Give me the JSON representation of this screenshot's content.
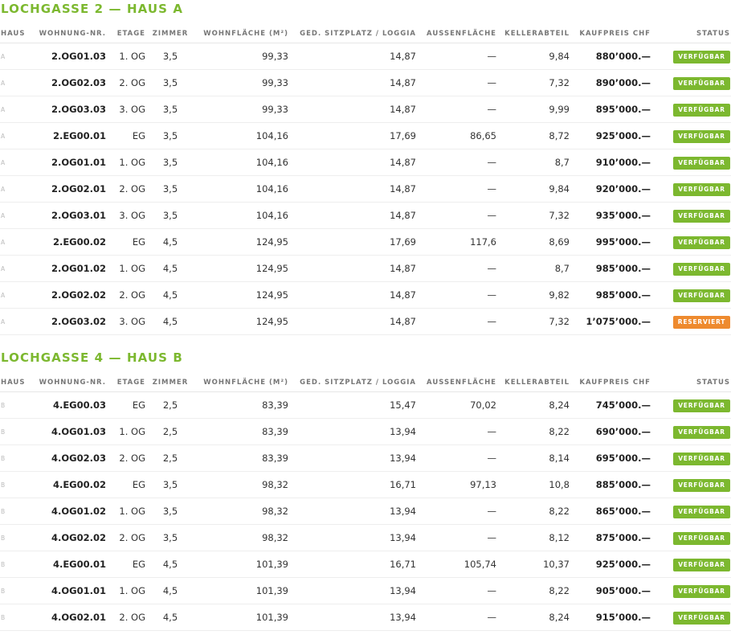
{
  "colors": {
    "accent": "#7cb82f",
    "available": "#7cb82f",
    "reserved": "#ee8a2e"
  },
  "columns": [
    "HAUS",
    "WOHNUNG-NR.",
    "ETAGE",
    "ZIMMER",
    "WOHNFLÄCHE (M²)",
    "GED. SITZPLATZ / LOGGIA",
    "AUSSENFLÄCHE",
    "KELLERABTEIL",
    "KAUFPREIS CHF",
    "STATUS"
  ],
  "sections": [
    {
      "title": "LOCHGASSE 2 — HAUS A",
      "rows": [
        [
          "A",
          "2.OG01.03",
          "1. OG",
          "3,5",
          "99,33",
          "14,87",
          "—",
          "9,84",
          "880’000.—",
          "VERFÜGBAR"
        ],
        [
          "A",
          "2.OG02.03",
          "2. OG",
          "3,5",
          "99,33",
          "14,87",
          "—",
          "7,32",
          "890’000.—",
          "VERFÜGBAR"
        ],
        [
          "A",
          "2.OG03.03",
          "3. OG",
          "3,5",
          "99,33",
          "14,87",
          "—",
          "9,99",
          "895’000.—",
          "VERFÜGBAR"
        ],
        [
          "A",
          "2.EG00.01",
          "EG",
          "3,5",
          "104,16",
          "17,69",
          "86,65",
          "8,72",
          "925’000.—",
          "VERFÜGBAR"
        ],
        [
          "A",
          "2.OG01.01",
          "1. OG",
          "3,5",
          "104,16",
          "14,87",
          "—",
          "8,7",
          "910’000.—",
          "VERFÜGBAR"
        ],
        [
          "A",
          "2.OG02.01",
          "2. OG",
          "3,5",
          "104,16",
          "14,87",
          "—",
          "9,84",
          "920’000.—",
          "VERFÜGBAR"
        ],
        [
          "A",
          "2.OG03.01",
          "3. OG",
          "3,5",
          "104,16",
          "14,87",
          "—",
          "7,32",
          "935’000.—",
          "VERFÜGBAR"
        ],
        [
          "A",
          "2.EG00.02",
          "EG",
          "4,5",
          "124,95",
          "17,69",
          "117,6",
          "8,69",
          "995’000.—",
          "VERFÜGBAR"
        ],
        [
          "A",
          "2.OG01.02",
          "1. OG",
          "4,5",
          "124,95",
          "14,87",
          "—",
          "8,7",
          "985’000.—",
          "VERFÜGBAR"
        ],
        [
          "A",
          "2.OG02.02",
          "2. OG",
          "4,5",
          "124,95",
          "14,87",
          "—",
          "9,82",
          "985’000.—",
          "VERFÜGBAR"
        ],
        [
          "A",
          "2.OG03.02",
          "3. OG",
          "4,5",
          "124,95",
          "14,87",
          "—",
          "7,32",
          "1’075’000.—",
          "RESERVIERT"
        ]
      ]
    },
    {
      "title": "LOCHGASSE 4 — HAUS B",
      "rows": [
        [
          "B",
          "4.EG00.03",
          "EG",
          "2,5",
          "83,39",
          "15,47",
          "70,02",
          "8,24",
          "745’000.—",
          "VERFÜGBAR"
        ],
        [
          "B",
          "4.OG01.03",
          "1. OG",
          "2,5",
          "83,39",
          "13,94",
          "—",
          "8,22",
          "690’000.—",
          "VERFÜGBAR"
        ],
        [
          "B",
          "4.OG02.03",
          "2. OG",
          "2,5",
          "83,39",
          "13,94",
          "—",
          "8,14",
          "695’000.—",
          "VERFÜGBAR"
        ],
        [
          "B",
          "4.EG00.02",
          "EG",
          "3,5",
          "98,32",
          "16,71",
          "97,13",
          "10,8",
          "885’000.—",
          "VERFÜGBAR"
        ],
        [
          "B",
          "4.OG01.02",
          "1. OG",
          "3,5",
          "98,32",
          "13,94",
          "—",
          "8,22",
          "865’000.—",
          "VERFÜGBAR"
        ],
        [
          "B",
          "4.OG02.02",
          "2. OG",
          "3,5",
          "98,32",
          "13,94",
          "—",
          "8,12",
          "875’000.—",
          "VERFÜGBAR"
        ],
        [
          "B",
          "4.EG00.01",
          "EG",
          "4,5",
          "101,39",
          "16,71",
          "105,74",
          "10,37",
          "925’000.—",
          "VERFÜGBAR"
        ],
        [
          "B",
          "4.OG01.01",
          "1. OG",
          "4,5",
          "101,39",
          "13,94",
          "—",
          "8,22",
          "905’000.—",
          "VERFÜGBAR"
        ],
        [
          "B",
          "4.OG02.01",
          "2. OG",
          "4,5",
          "101,39",
          "13,94",
          "—",
          "8,24",
          "915’000.—",
          "VERFÜGBAR"
        ]
      ]
    }
  ]
}
